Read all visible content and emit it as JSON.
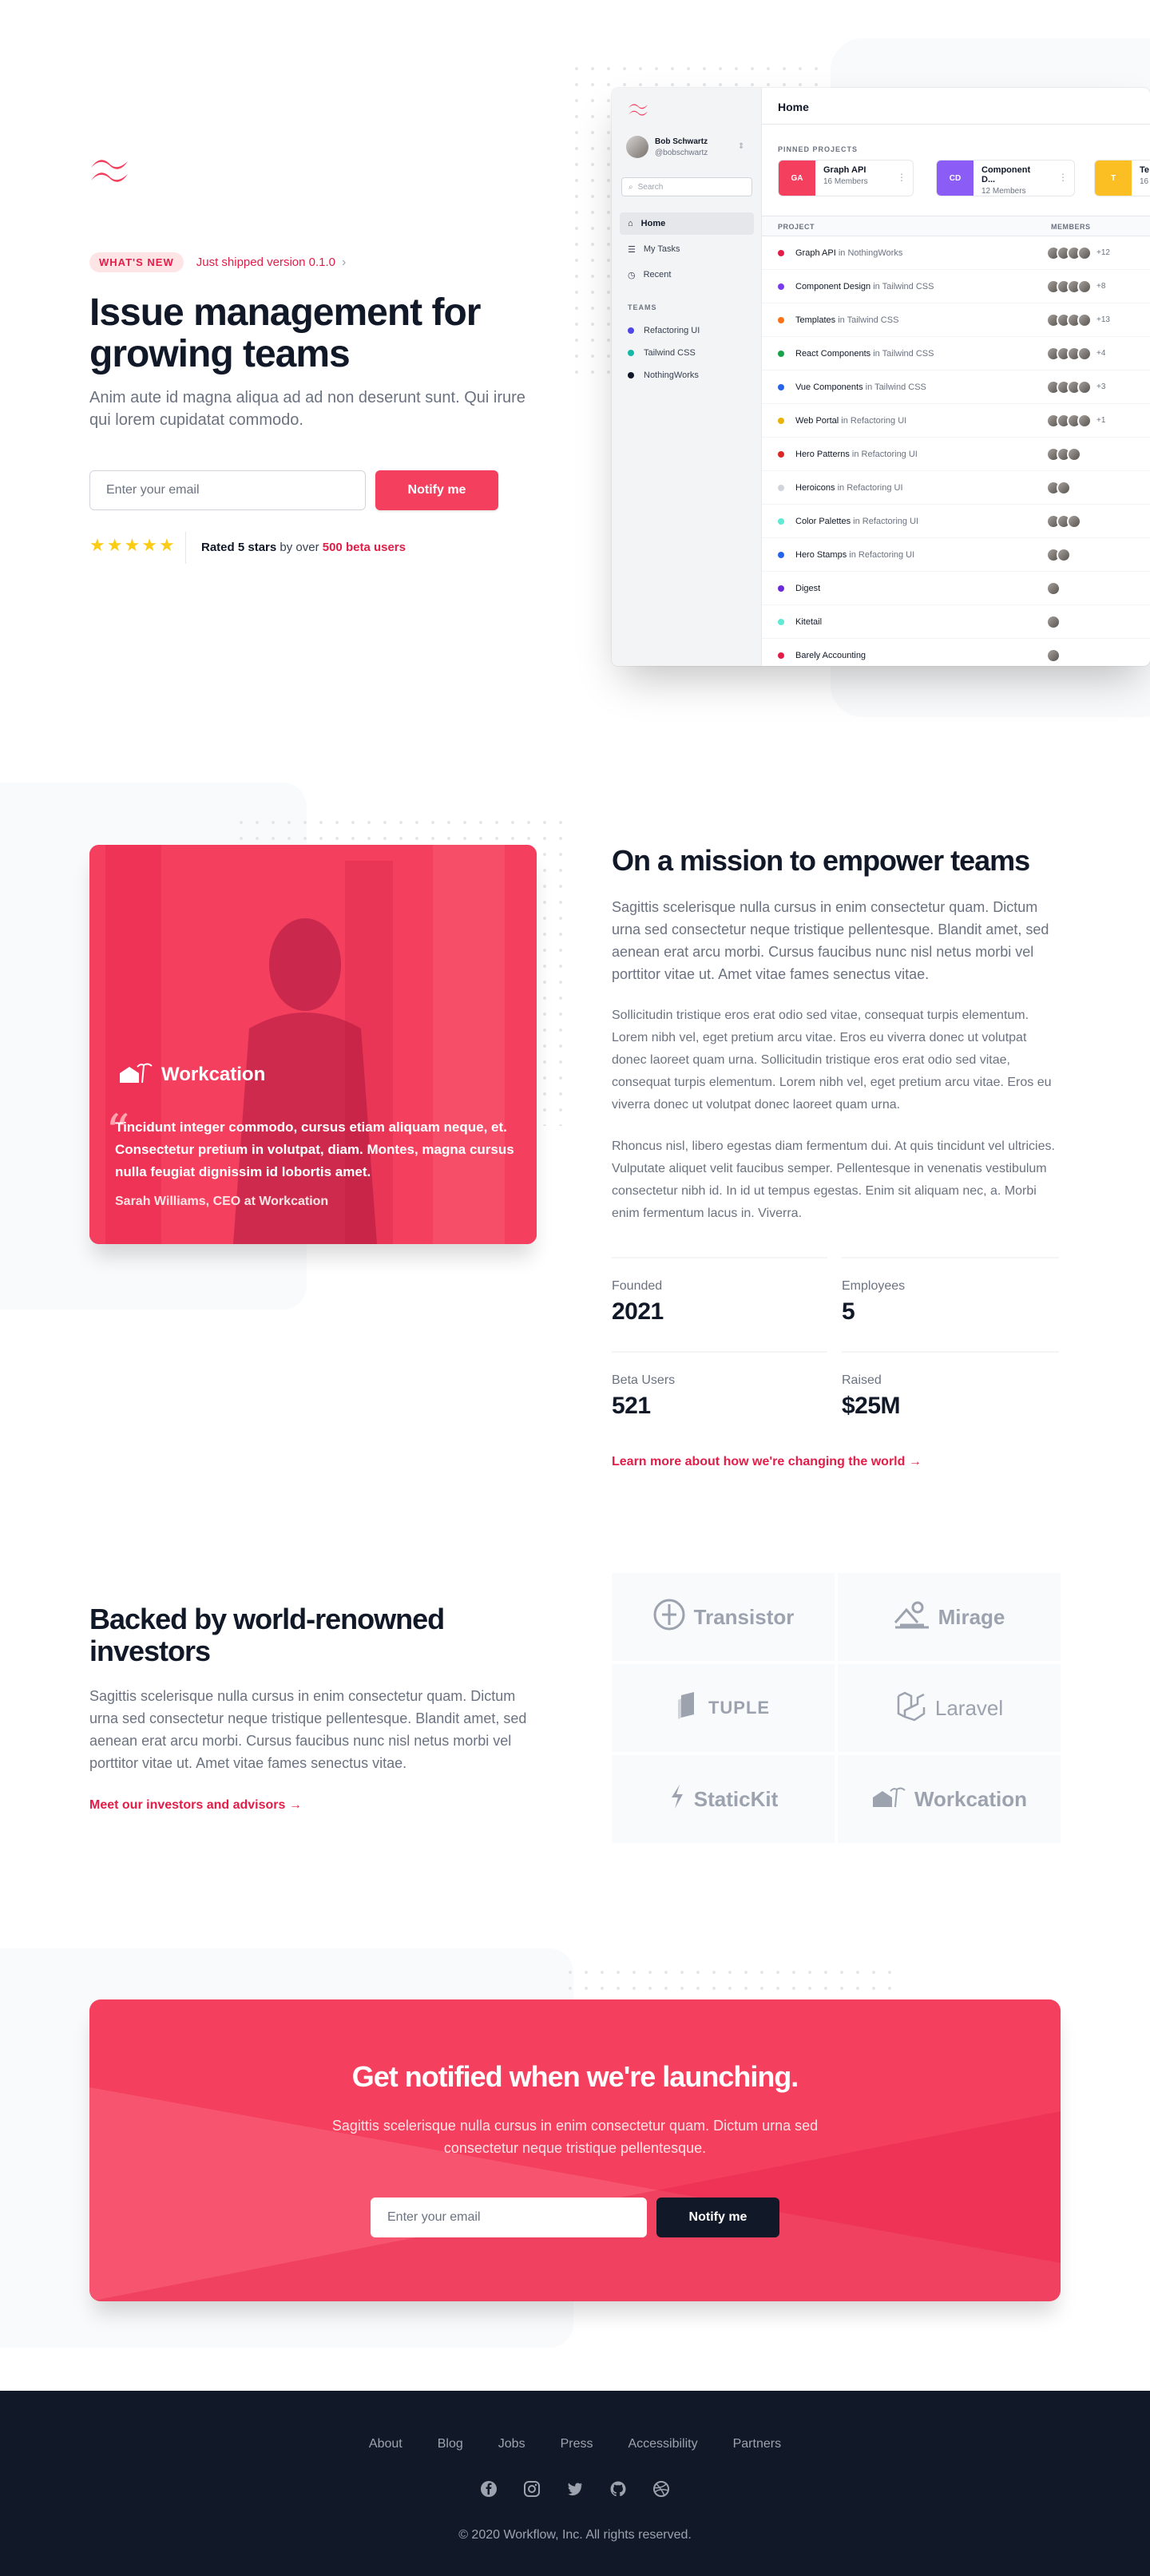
{
  "hero": {
    "badge": "WHAT'S NEW",
    "badge_link": "Just shipped version 0.1.0",
    "title_line1": "Issue management for",
    "title_line2": "growing teams",
    "subtitle": "Anim aute id magna aliqua ad ad non deserunt sunt. Qui irure qui lorem cupidatat commodo.",
    "email_placeholder": "Enter your email",
    "notify_label": "Notify me",
    "rating_prefix": "Rated 5 stars",
    "rating_mid": " by over ",
    "rating_highlight": "500 beta users",
    "stars": 5
  },
  "app": {
    "user_name": "Bob Schwartz",
    "user_handle": "@bobschwartz",
    "search_placeholder": "Search",
    "nav": [
      {
        "label": "Home",
        "icon": "home-icon"
      },
      {
        "label": "My Tasks",
        "icon": "list-icon"
      },
      {
        "label": "Recent",
        "icon": "clock-icon"
      }
    ],
    "teams_heading": "TEAMS",
    "teams": [
      {
        "label": "Refactoring UI",
        "color": "#4f46e5"
      },
      {
        "label": "Tailwind CSS",
        "color": "#14b8a6"
      },
      {
        "label": "NothingWorks",
        "color": "#111827"
      }
    ],
    "header_title": "Home",
    "pinned_heading": "PINNED PROJECTS",
    "pinned": [
      {
        "initials": "GA",
        "name": "Graph API",
        "members": "16 Members",
        "color": "#f43f5e"
      },
      {
        "initials": "CD",
        "name": "Component D...",
        "members": "12 Members",
        "color": "#8b5cf6"
      },
      {
        "initials": "T",
        "name": "Te",
        "members": "16",
        "color": "#fbbf24"
      }
    ],
    "col_project": "PROJECT",
    "col_members": "MEMBERS",
    "rows": [
      {
        "name": "Graph API",
        "team": " in NothingWorks",
        "dot": "#e11d48",
        "avatars": 4,
        "more": "+12"
      },
      {
        "name": "Component Design",
        "team": " in Tailwind CSS",
        "dot": "#7c3aed",
        "avatars": 4,
        "more": "+8"
      },
      {
        "name": "Templates",
        "team": " in Tailwind CSS",
        "dot": "#f97316",
        "avatars": 4,
        "more": "+13"
      },
      {
        "name": "React Components",
        "team": " in Tailwind CSS",
        "dot": "#16a34a",
        "avatars": 4,
        "more": "+4"
      },
      {
        "name": "Vue Components",
        "team": " in Tailwind CSS",
        "dot": "#2563eb",
        "avatars": 4,
        "more": "+3"
      },
      {
        "name": "Web Portal",
        "team": " in Refactoring UI",
        "dot": "#eab308",
        "avatars": 4,
        "more": "+1"
      },
      {
        "name": "Hero Patterns",
        "team": " in Refactoring UI",
        "dot": "#dc2626",
        "avatars": 3,
        "more": ""
      },
      {
        "name": "Heroicons",
        "team": " in Refactoring UI",
        "dot": "#d1d5db",
        "avatars": 2,
        "more": ""
      },
      {
        "name": "Color Palettes",
        "team": " in Refactoring UI",
        "dot": "#5eead4",
        "avatars": 3,
        "more": ""
      },
      {
        "name": "Hero Stamps",
        "team": " in Refactoring UI",
        "dot": "#2563eb",
        "avatars": 2,
        "more": ""
      },
      {
        "name": "Digest",
        "team": "",
        "dot": "#6d28d9",
        "avatars": 1,
        "more": ""
      },
      {
        "name": "Kitetail",
        "team": "",
        "dot": "#5eead4",
        "avatars": 1,
        "more": ""
      },
      {
        "name": "Barely Accounting",
        "team": "",
        "dot": "#e11d48",
        "avatars": 1,
        "more": ""
      }
    ]
  },
  "mission": {
    "card_brand": "Workcation",
    "quote": "Tincidunt integer commodo, cursus etiam aliquam neque, et. Consectetur pretium in volutpat, diam. Montes, magna cursus nulla feugiat dignissim id lobortis amet.",
    "quote_author": "Sarah Williams, CEO at Workcation",
    "title": "On a mission to empower teams",
    "lead": "Sagittis scelerisque nulla cursus in enim consectetur quam. Dictum urna sed consectetur neque tristique pellentesque. Blandit amet, sed aenean erat arcu morbi. Cursus faucibus nunc nisl netus morbi vel porttitor vitae ut. Amet vitae fames senectus vitae.",
    "p1": "Sollicitudin tristique eros erat odio sed vitae, consequat turpis elementum. Lorem nibh vel, eget pretium arcu vitae. Eros eu viverra donec ut volutpat donec laoreet quam urna. Sollicitudin tristique eros erat odio sed vitae, consequat turpis elementum. Lorem nibh vel, eget pretium arcu vitae. Eros eu viverra donec ut volutpat donec laoreet quam urna.",
    "p2": "Rhoncus nisl, libero egestas diam fermentum dui. At quis tincidunt vel ultricies. Vulputate aliquet velit faucibus semper. Pellentesque in venenatis vestibulum consectetur nibh id. In id ut tempus egestas. Enim sit aliquam nec, a. Morbi enim fermentum lacus in. Viverra.",
    "stats": [
      {
        "label": "Founded",
        "value": "2021"
      },
      {
        "label": "Employees",
        "value": "5"
      },
      {
        "label": "Beta Users",
        "value": "521"
      },
      {
        "label": "Raised",
        "value": "$25M"
      }
    ],
    "link": "Learn more about how we're changing the world →"
  },
  "investors": {
    "title_line1": "Backed by world-renowned",
    "title_line2": "investors",
    "body": "Sagittis scelerisque nulla cursus in enim consectetur quam. Dictum urna sed consectetur neque tristique pellentesque. Blandit amet, sed aenean erat arcu morbi. Cursus faucibus nunc nisl netus morbi vel porttitor vitae ut. Amet vitae fames senectus vitae.",
    "link": "Meet our investors and advisors →",
    "logos": [
      {
        "name": "Transistor",
        "icon": "transistor-logo-icon"
      },
      {
        "name": "Mirage",
        "icon": "mirage-logo-icon"
      },
      {
        "name": "TUPLE",
        "icon": "tuple-logo-icon"
      },
      {
        "name": "Laravel",
        "icon": "laravel-logo-icon"
      },
      {
        "name": "StaticKit",
        "icon": "statickit-logo-icon"
      },
      {
        "name": "Workcation",
        "icon": "workcation-logo-icon"
      }
    ]
  },
  "cta": {
    "title": "Get notified when we're launching.",
    "subtitle": "Sagittis scelerisque nulla cursus in enim consectetur quam. Dictum urna sed consectetur neque tristique pellentesque.",
    "email_placeholder": "Enter your email",
    "notify_label": "Notify me"
  },
  "footer": {
    "links": [
      "About",
      "Blog",
      "Jobs",
      "Press",
      "Accessibility",
      "Partners"
    ],
    "socials": [
      "facebook-icon",
      "instagram-icon",
      "twitter-icon",
      "github-icon",
      "dribbble-icon"
    ],
    "copyright": "© 2020 Workflow, Inc. All rights reserved."
  },
  "colors": {
    "accent": "#f43f5e",
    "accent_dark": "#e11d48",
    "footer_bg": "#111827"
  }
}
